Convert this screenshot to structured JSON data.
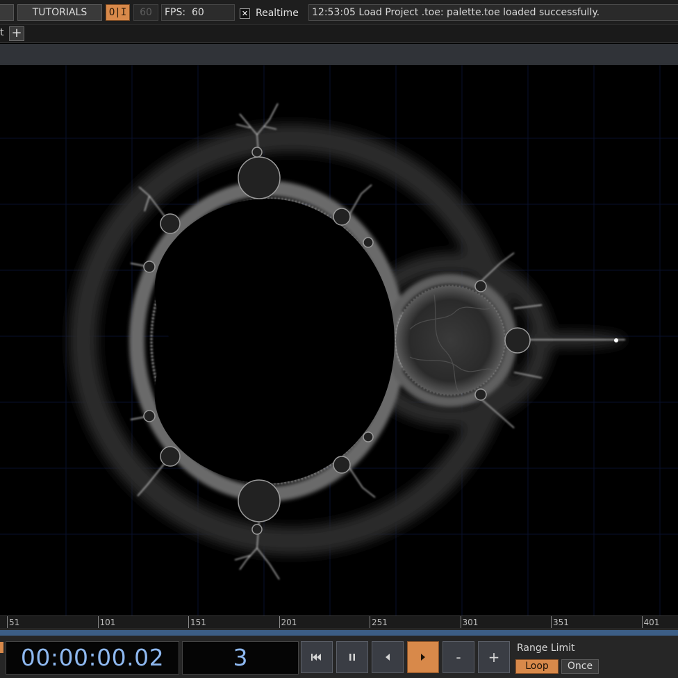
{
  "toolbar": {
    "tutorials_label": "TUTORIALS",
    "perform_label": "O|I",
    "fps_cap": "60",
    "fps_label": "FPS:",
    "fps_value": "60",
    "realtime_label": "Realtime",
    "realtime_checked": true,
    "status_message": "12:53:05 Load Project .toe: palette.toe loaded successfully."
  },
  "tabs": {
    "partial_label": "t",
    "add_label": "+"
  },
  "timeline": {
    "ticks": [
      "51",
      "101",
      "151",
      "201",
      "251",
      "301",
      "351",
      "401"
    ]
  },
  "transport": {
    "timecode": "00:00:00.02",
    "frame": "3",
    "minus_label": "-",
    "plus_label": "+",
    "range_limit_label": "Range Limit",
    "loop_label": "Loop",
    "once_label": "Once",
    "active_mode": "Loop"
  },
  "colors": {
    "accent_orange": "#d8894a",
    "timecode_blue": "#8eb8f0",
    "timeline_fill": "#3c5e86"
  },
  "icons": {
    "rewind": "skip-to-start-icon",
    "pause": "pause-icon",
    "step_back": "step-back-icon",
    "play": "play-icon"
  }
}
